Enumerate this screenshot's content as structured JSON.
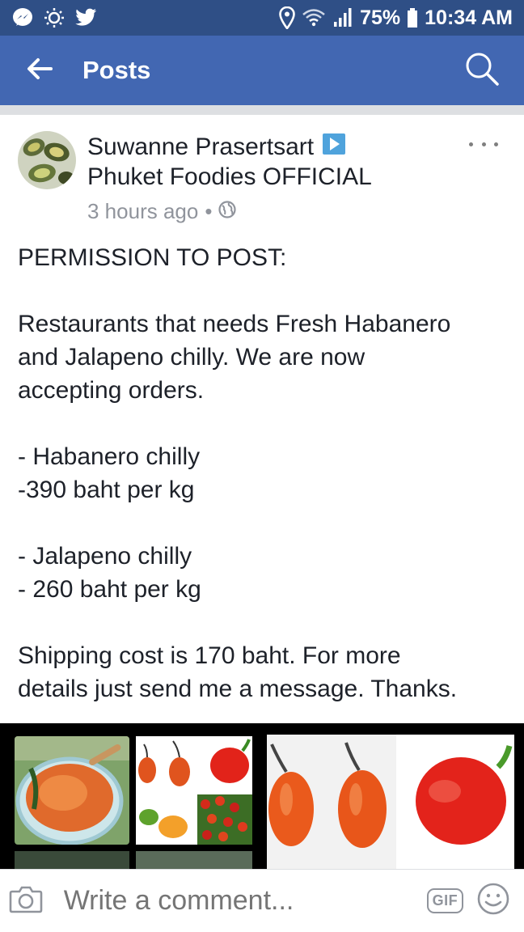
{
  "status_bar": {
    "left_icons": [
      "messenger-icon",
      "sun-icon",
      "twitter-icon"
    ],
    "right_icons": [
      "location-icon",
      "wifi-icon",
      "signal-icon"
    ],
    "battery_text": "75%",
    "time": "10:34 AM"
  },
  "app_bar": {
    "title": "Posts",
    "back_icon": "arrow-left-icon",
    "search_icon": "search-icon",
    "color": "#4267b2"
  },
  "post": {
    "author": "Suwanne Prasertsart",
    "group": "Phuket Foodies OFFICIAL",
    "timestamp": "3 hours ago",
    "separator": "•",
    "privacy_icon": "globe-icon",
    "body": {
      "line1": "PERMISSION TO POST:",
      "line2": "Restaurants that needs Fresh Habanero",
      "line3": "and Jalapeno chilly. We are now",
      "line4": "accepting orders.",
      "line5": "- Habanero chilly",
      "line6": "-390 baht per kg",
      "line7": "- Jalapeno chilly",
      "line8": "- 260 baht per kg",
      "line9": "Shipping cost is 170 baht. For more",
      "line10": "details just send me a message. Thanks."
    }
  },
  "comment_bar": {
    "placeholder": "Write a comment...",
    "gif_label": "GIF",
    "camera_icon": "camera-icon",
    "emoji_icon": "emoji-icon"
  }
}
